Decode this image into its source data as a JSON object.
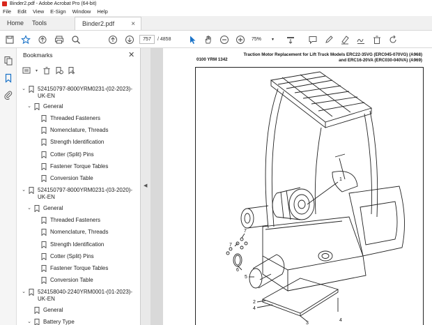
{
  "window": {
    "title": "Binder2.pdf - Adobe Acrobat Pro (64-bit)"
  },
  "menu": [
    "File",
    "Edit",
    "View",
    "E-Sign",
    "Window",
    "Help"
  ],
  "tabs": {
    "home": "Home",
    "tools": "Tools",
    "document": "Binder2.pdf",
    "close": "×"
  },
  "toolbar": {
    "page_current": "757",
    "page_total": "/ 4858",
    "zoom": "75%"
  },
  "bookmarks": {
    "title": "Bookmarks",
    "items": [
      {
        "level": 0,
        "expanded": true,
        "label1": "524150797-8000YRM0231-(02-2023)-",
        "label2": "UK-EN"
      },
      {
        "level": 1,
        "expanded": true,
        "label1": "General"
      },
      {
        "level": 2,
        "label1": "Threaded Fasteners"
      },
      {
        "level": 2,
        "label1": "Nomenclature, Threads"
      },
      {
        "level": 2,
        "label1": "Strength Identification"
      },
      {
        "level": 2,
        "label1": "Cotter (Split) Pins"
      },
      {
        "level": 2,
        "label1": "Fastener Torque Tables"
      },
      {
        "level": 2,
        "label1": "Conversion Table"
      },
      {
        "level": 0,
        "expanded": true,
        "label1": "524150797-8000YRM0231-(03-2020)-",
        "label2": "UK-EN"
      },
      {
        "level": 1,
        "expanded": true,
        "label1": "General"
      },
      {
        "level": 2,
        "label1": "Threaded Fasteners"
      },
      {
        "level": 2,
        "label1": "Nomenclature, Threads"
      },
      {
        "level": 2,
        "label1": "Strength Identification"
      },
      {
        "level": 2,
        "label1": "Cotter (Split) Pins"
      },
      {
        "level": 2,
        "label1": "Fastener Torque Tables"
      },
      {
        "level": 2,
        "label1": "Conversion Table"
      },
      {
        "level": 0,
        "expanded": true,
        "label1": "524158040-2240YRM0001-(01-2023)-",
        "label2": "UK-EN"
      },
      {
        "level": 2,
        "label1": "General"
      },
      {
        "level": 1,
        "expanded": true,
        "label1": "Battery Type"
      }
    ]
  },
  "document": {
    "header_line1": "Traction Motor Replacement for Lift Truck Models ERC22-35VG (ERC045-070VG) (A968)",
    "header_line2": "and ERC16-20VA (ERC030-040VA) (A969)",
    "header_left": "0100 YRM 1342",
    "callouts": [
      "1",
      "2",
      "3",
      "4",
      "5",
      "6",
      "7",
      "7",
      "4"
    ]
  }
}
